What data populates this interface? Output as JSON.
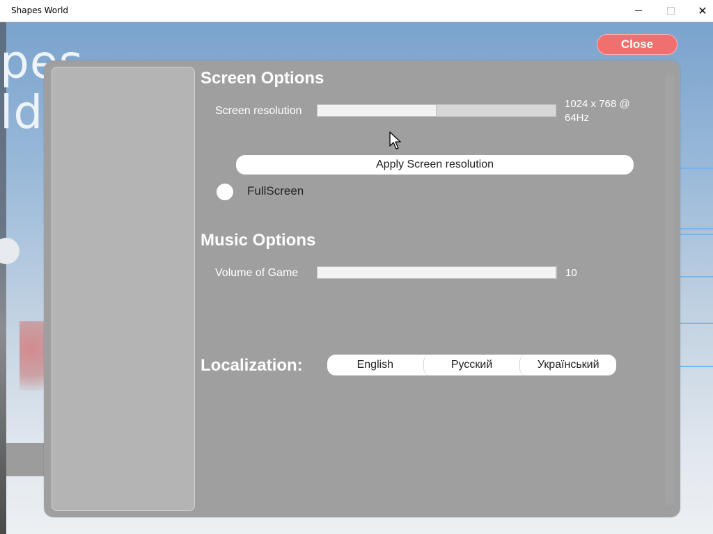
{
  "window": {
    "title": "Shapes World",
    "minimize_icon": "minimize-icon",
    "maximize_icon": "maximize-icon",
    "close_symbol": "✕"
  },
  "background": {
    "logo_fragment": "pes\nld"
  },
  "header": {
    "close_label": "Close"
  },
  "screen_options": {
    "title": "Screen Options",
    "resolution_label": "Screen resolution",
    "resolution_slider_fraction": 0.5,
    "resolution_value": "1024 x 768 @\n64Hz",
    "apply_label": "Apply Screen resolution",
    "fullscreen_label": "FullScreen",
    "fullscreen_on": false
  },
  "music_options": {
    "title": "Music Options",
    "volume_label": "Volume of Game",
    "volume_value": "10",
    "volume_slider_fraction": 1.0
  },
  "localization": {
    "title": "Localization:",
    "languages": [
      "English",
      "Русский",
      "Український"
    ]
  },
  "colors": {
    "panel": "#9f9f9f",
    "sidebar": "#b4b4b4",
    "close_button": "#f07070",
    "accent_lines": "#74b6ef"
  }
}
